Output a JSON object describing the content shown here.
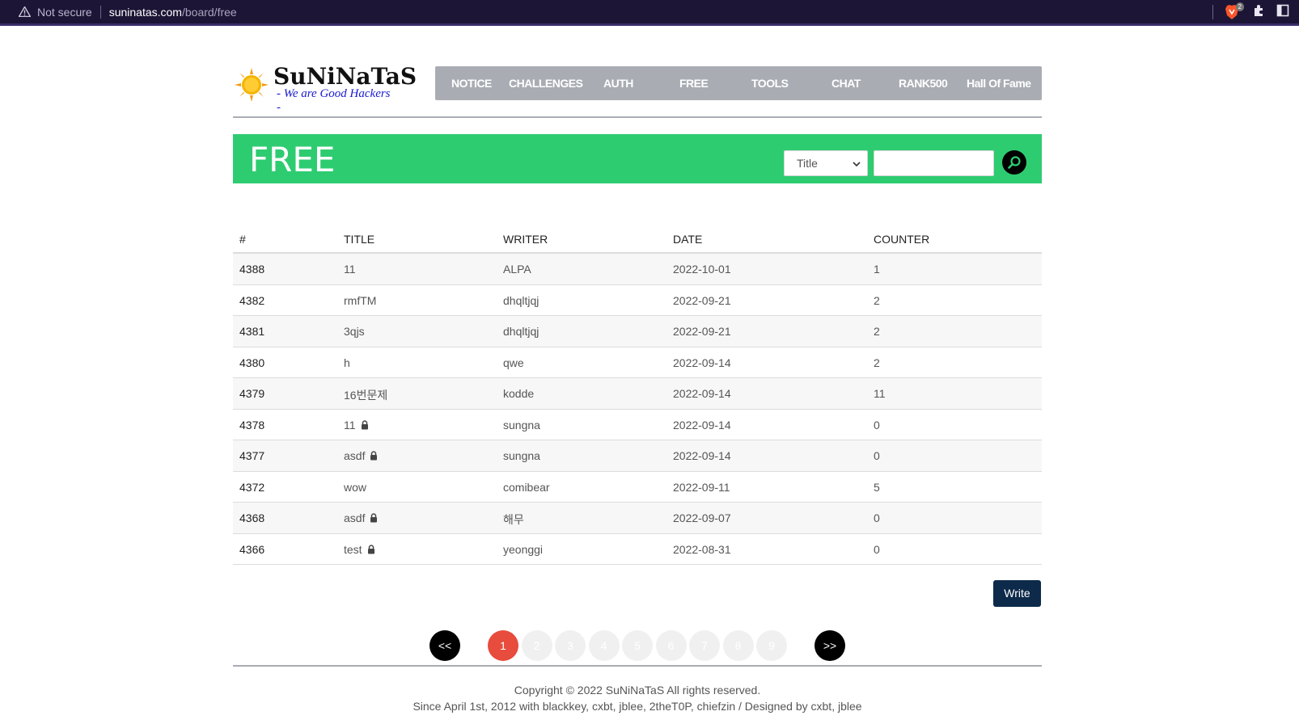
{
  "browser": {
    "security_text": "Not secure",
    "url_host": "suninatas.com",
    "url_path": "/board/free",
    "shields_badge": "2"
  },
  "logo": {
    "title": "SuNiNaTaS",
    "subtitle": "- We are Good Hackers -"
  },
  "nav": [
    "NOTICE",
    "CHALLENGES",
    "AUTH",
    "FREE",
    "TOOLS",
    "CHAT",
    "RANK500",
    "Hall Of Fame"
  ],
  "banner": {
    "title": "FREE",
    "search_field_selected": "Title",
    "search_value": ""
  },
  "table": {
    "headers": [
      "#",
      "TITLE",
      "WRITER",
      "DATE",
      "COUNTER"
    ],
    "rows": [
      {
        "num": "4388",
        "title": "11",
        "locked": false,
        "writer": "ALPA",
        "date": "2022-10-01",
        "counter": "1"
      },
      {
        "num": "4382",
        "title": "rmfTM",
        "locked": false,
        "writer": "dhqltjqj",
        "date": "2022-09-21",
        "counter": "2"
      },
      {
        "num": "4381",
        "title": "3qjs",
        "locked": false,
        "writer": "dhqltjqj",
        "date": "2022-09-21",
        "counter": "2"
      },
      {
        "num": "4380",
        "title": "h",
        "locked": false,
        "writer": "qwe",
        "date": "2022-09-14",
        "counter": "2"
      },
      {
        "num": "4379",
        "title": "16번문제",
        "locked": false,
        "writer": "kodde",
        "date": "2022-09-14",
        "counter": "11"
      },
      {
        "num": "4378",
        "title": "11",
        "locked": true,
        "writer": "sungna",
        "date": "2022-09-14",
        "counter": "0"
      },
      {
        "num": "4377",
        "title": "asdf",
        "locked": true,
        "writer": "sungna",
        "date": "2022-09-14",
        "counter": "0"
      },
      {
        "num": "4372",
        "title": "wow",
        "locked": false,
        "writer": "comibear",
        "date": "2022-09-11",
        "counter": "5"
      },
      {
        "num": "4368",
        "title": "asdf",
        "locked": true,
        "writer": "해무",
        "date": "2022-09-07",
        "counter": "0"
      },
      {
        "num": "4366",
        "title": "test",
        "locked": true,
        "writer": "yeonggi",
        "date": "2022-08-31",
        "counter": "0"
      }
    ]
  },
  "write_label": "Write",
  "pagination": {
    "prev": "<<",
    "next": ">>",
    "pages": [
      "1",
      "2",
      "3",
      "4",
      "5",
      "6",
      "7",
      "8",
      "9"
    ],
    "current": "1"
  },
  "footer": {
    "line1": "Copyright © 2022 SuNiNaTaS All rights reserved.",
    "line2": "Since April 1st, 2012 with blackkey, cxbt, jblee, 2theT0P, chiefzin / Designed by cxbt, jblee"
  },
  "colors": {
    "banner": "#2ecc71",
    "nav": "#a9adb3",
    "active_page": "#e74c3c",
    "write_button": "#0d2a4a"
  }
}
